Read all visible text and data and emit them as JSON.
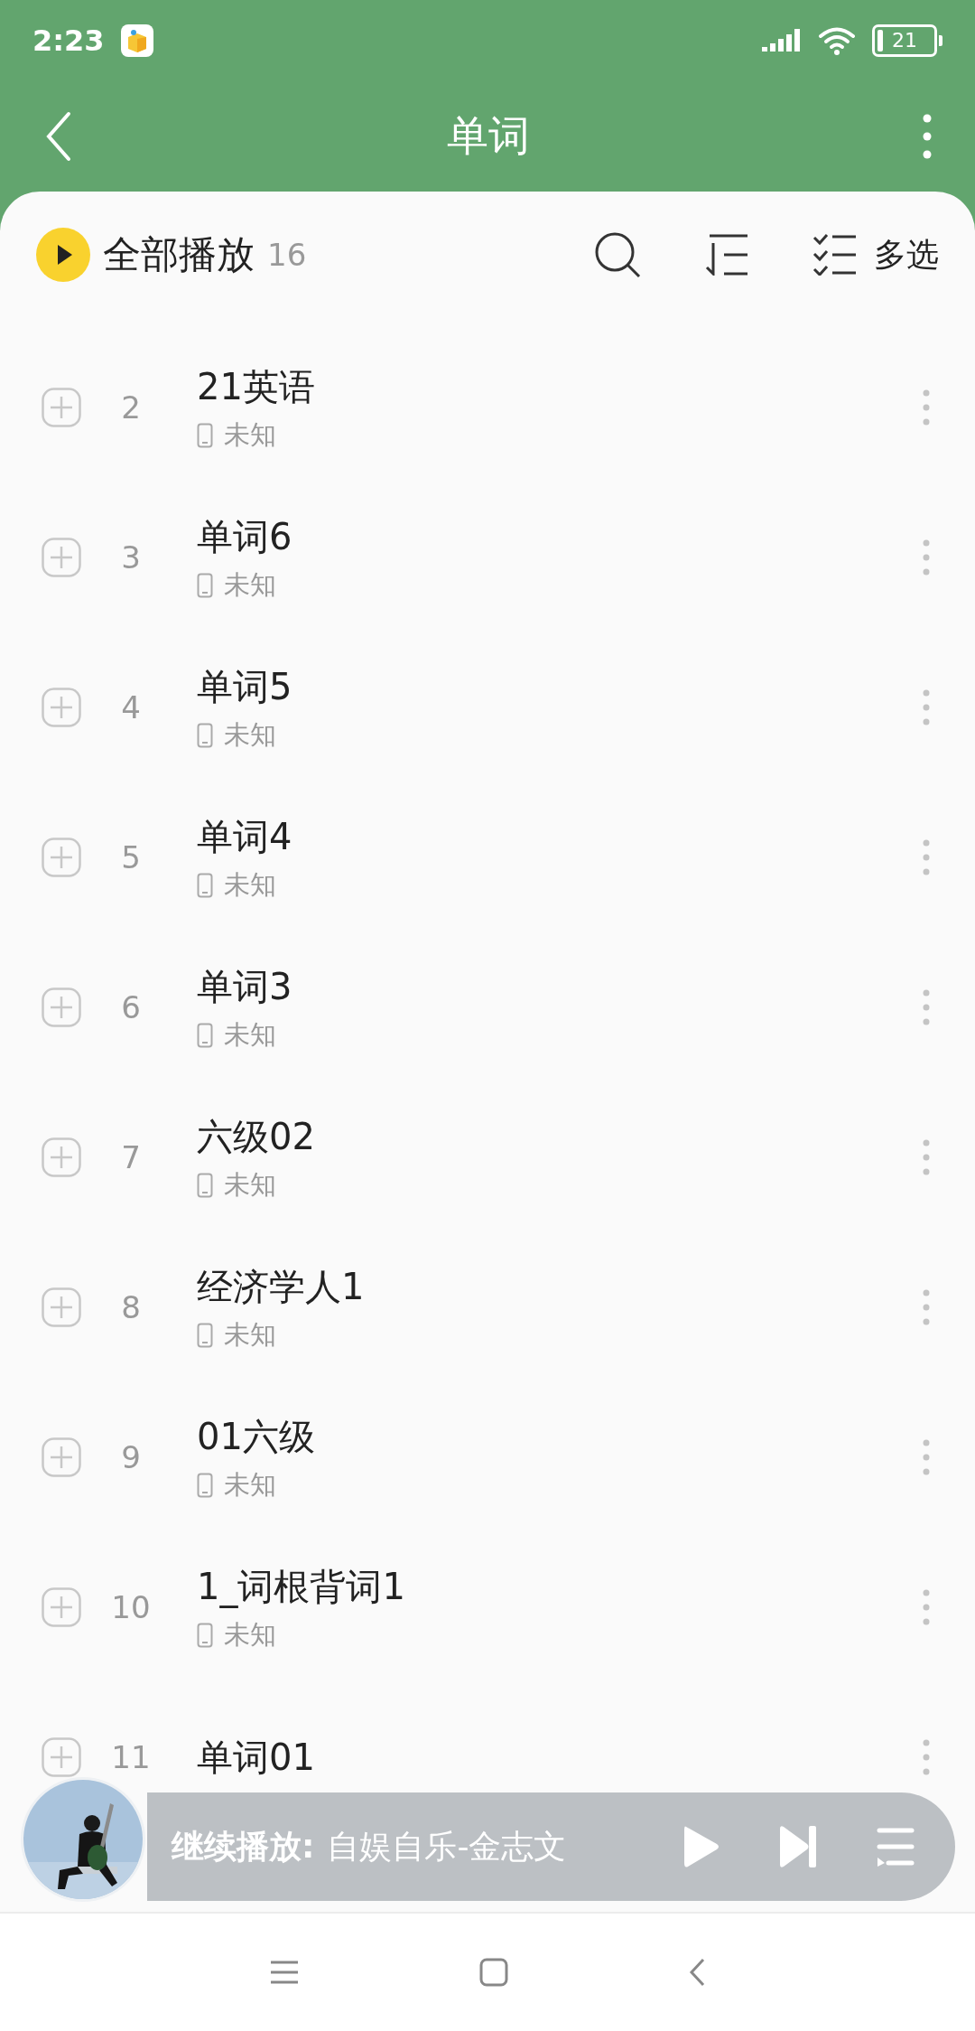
{
  "status_bar": {
    "time": "2:23",
    "battery": "21"
  },
  "header": {
    "title": "单词"
  },
  "toolbar": {
    "play_all": "全部播放",
    "count": "16",
    "multi_select": "多选"
  },
  "songs": [
    {
      "number": "2",
      "title": "21英语",
      "source": "未知"
    },
    {
      "number": "3",
      "title": "单词6",
      "source": "未知"
    },
    {
      "number": "4",
      "title": "单词5",
      "source": "未知"
    },
    {
      "number": "5",
      "title": "单词4",
      "source": "未知"
    },
    {
      "number": "6",
      "title": "单词3",
      "source": "未知"
    },
    {
      "number": "7",
      "title": "六级02",
      "source": "未知"
    },
    {
      "number": "8",
      "title": "经济学人1",
      "source": "未知"
    },
    {
      "number": "9",
      "title": "01六级",
      "source": "未知"
    },
    {
      "number": "10",
      "title": "1_词根背词1",
      "source": "未知"
    },
    {
      "number": "11",
      "title": "单词01"
    }
  ],
  "player": {
    "label": "继续播放:",
    "track": "自娱自乐-金志文"
  }
}
